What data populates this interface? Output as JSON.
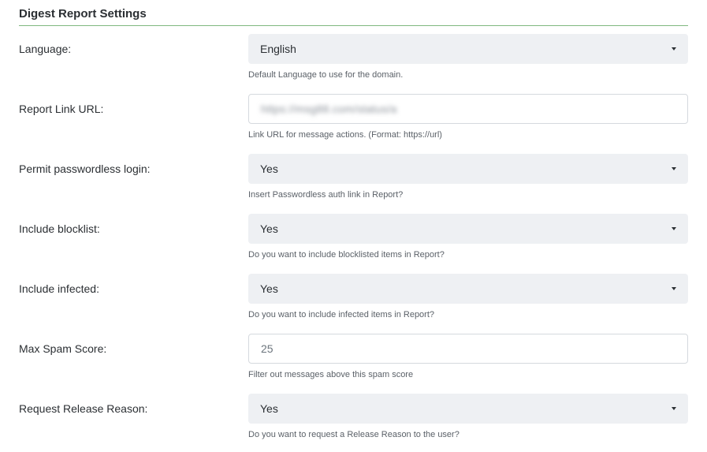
{
  "section": {
    "title": "Digest Report Settings"
  },
  "fields": [
    {
      "label": "Language:",
      "type": "select",
      "value": "English",
      "help": "Default Language to use for the domain."
    },
    {
      "label": "Report Link URL:",
      "type": "input",
      "value": "https://msg88.com/status/a",
      "help": "Link URL for message actions. (Format: https://url)"
    },
    {
      "label": "Permit passwordless login:",
      "type": "select",
      "value": "Yes",
      "help": "Insert Passwordless auth link in Report?"
    },
    {
      "label": "Include blocklist:",
      "type": "select",
      "value": "Yes",
      "help": "Do you want to include blocklisted items in Report?"
    },
    {
      "label": "Include infected:",
      "type": "select",
      "value": "Yes",
      "help": "Do you want to include infected items in Report?"
    },
    {
      "label": "Max Spam Score:",
      "type": "input",
      "value": "25",
      "help": "Filter out messages above this spam score"
    },
    {
      "label": "Request Release Reason:",
      "type": "select",
      "value": "Yes",
      "help": "Do you want to request a Release Reason to the user?"
    }
  ],
  "icons": {
    "dropdown": "caret-down-icon"
  }
}
